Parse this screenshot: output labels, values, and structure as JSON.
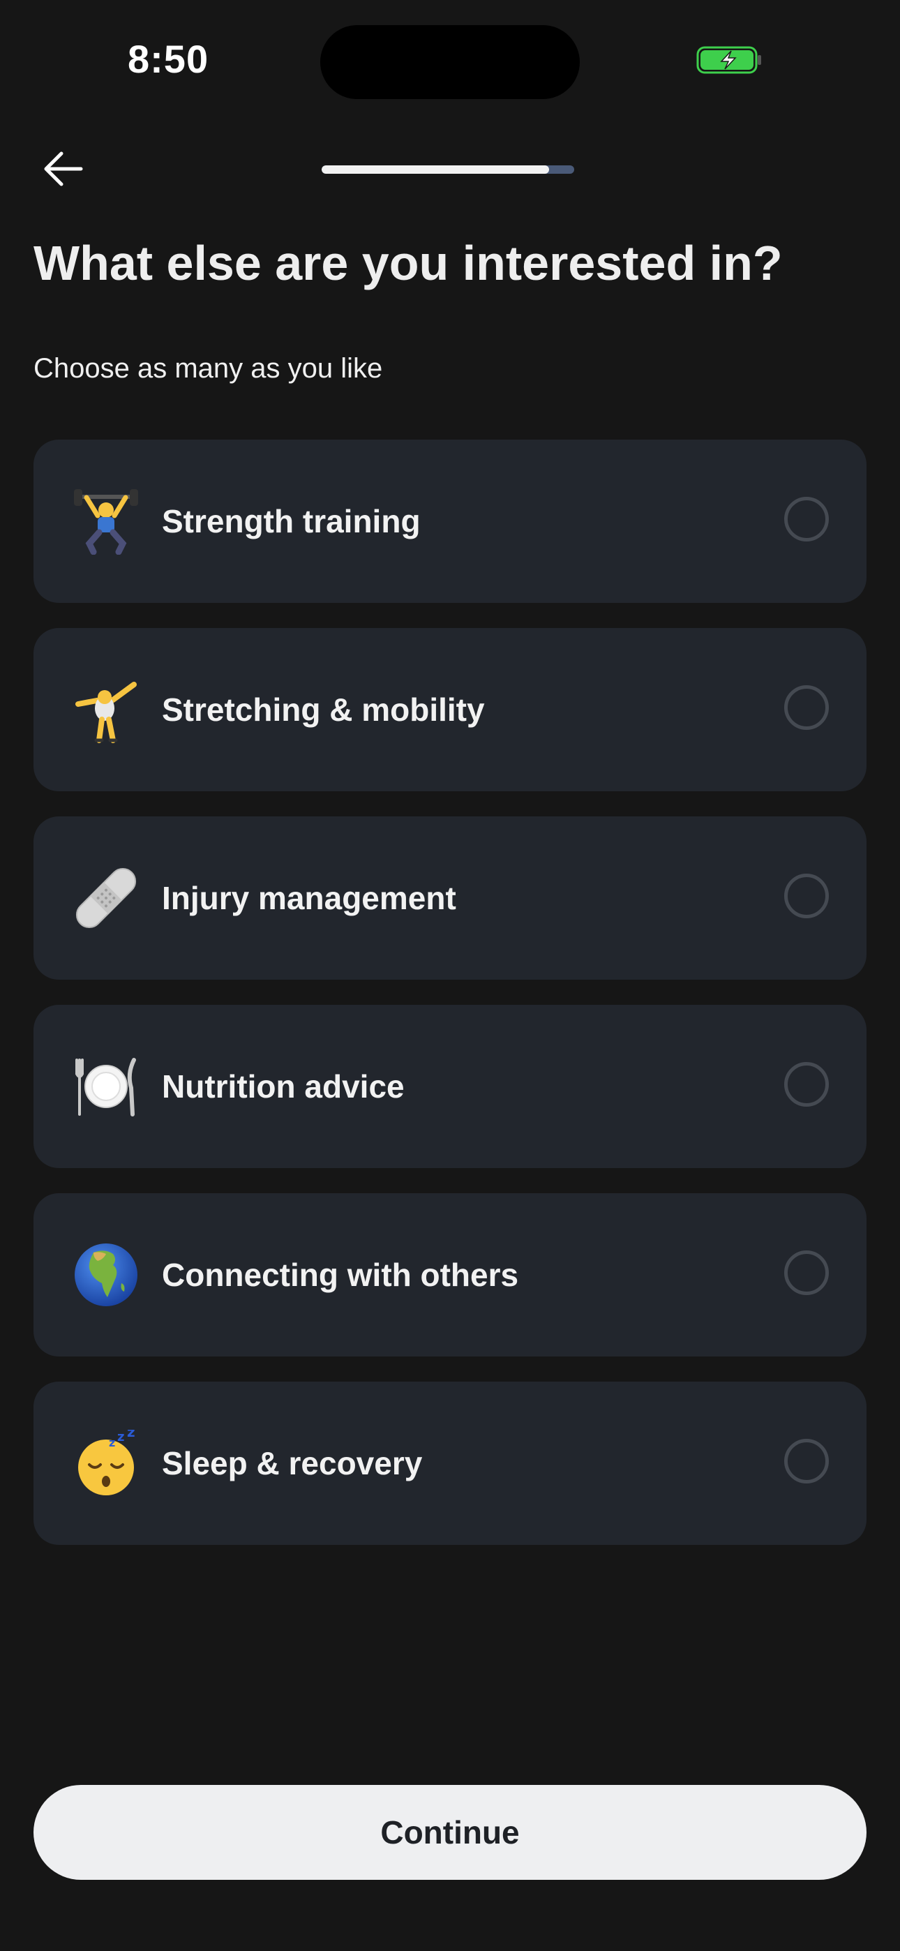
{
  "status_bar": {
    "time": "8:50",
    "battery_icon": "battery-charging-icon",
    "battery_color": "#3ecf4c"
  },
  "nav": {
    "back_icon": "arrow-left-icon",
    "progress_fraction": 0.9
  },
  "header": {
    "title": "What else are you interested in?",
    "subtitle": "Choose as many as you like"
  },
  "options": [
    {
      "label": "Strength training",
      "icon": "weightlifter-icon",
      "selected": false
    },
    {
      "label": "Stretching & mobility",
      "icon": "cartwheel-icon",
      "selected": false
    },
    {
      "label": "Injury management",
      "icon": "bandage-icon",
      "selected": false
    },
    {
      "label": "Nutrition advice",
      "icon": "plate-fork-knife-icon",
      "selected": false
    },
    {
      "label": "Connecting with others",
      "icon": "globe-icon",
      "selected": false
    },
    {
      "label": "Sleep & recovery",
      "icon": "sleeping-face-icon",
      "selected": false
    }
  ],
  "footer": {
    "continue_label": "Continue"
  },
  "colors": {
    "background": "#161616",
    "card": "#22262d",
    "progress_track": "#4a5a78",
    "button_bg": "#eeeff1"
  }
}
